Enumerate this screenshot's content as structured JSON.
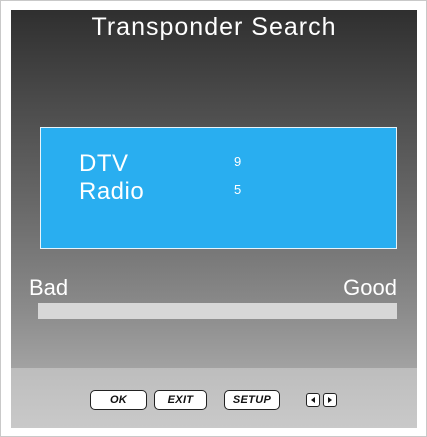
{
  "title": "Transponder Search",
  "info": {
    "dtv_label": "DTV",
    "dtv_value": "9",
    "radio_label": "Radio",
    "radio_value": "5",
    "box_color": "#29aef0"
  },
  "signal": {
    "bad_label": "Bad",
    "good_label": "Good",
    "level_percent": 0
  },
  "footer": {
    "ok_label": "OK",
    "exit_label": "EXIT",
    "setup_label": "SETUP",
    "left_icon": "left-arrow-icon",
    "right_icon": "right-arrow-icon"
  }
}
